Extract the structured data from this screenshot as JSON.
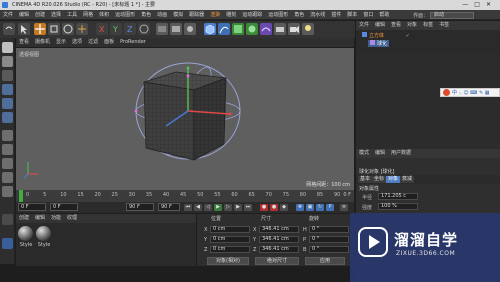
{
  "window": {
    "title": "CINEMA 4D R20.026 Studio (RC - R20) - [未标题 1 *] - 主要",
    "controls": [
      "—",
      "□",
      "✕"
    ]
  },
  "menubar": {
    "items": [
      "文件",
      "编辑",
      "创建",
      "选择",
      "工具",
      "网格",
      "体积",
      "运动图形",
      "角色",
      "动画",
      "模拟",
      "跟踪器",
      "渲染",
      "雕刻",
      "运动跟踪",
      "运动图形",
      "角色",
      "流水线",
      "插件",
      "脚本",
      "窗口",
      "帮助"
    ],
    "highlight_index": 12,
    "layout_label": "界面：",
    "layout_value": "启动"
  },
  "viewport": {
    "menu": [
      "查看",
      "摄像机",
      "显示",
      "选项",
      "过滤",
      "面板",
      "ProRender"
    ],
    "label": "透视视图",
    "grid_distance": "网格间距：100 cm"
  },
  "timeline": {
    "ticks": [
      "0",
      "5",
      "10",
      "15",
      "20",
      "25",
      "30",
      "35",
      "40",
      "45",
      "50",
      "55",
      "60",
      "65",
      "70",
      "75",
      "80",
      "85",
      "90"
    ],
    "end_label": "0 F"
  },
  "playbar": {
    "start": "0 F",
    "start2": "0 F",
    "end": "90 F",
    "end2": "90 F"
  },
  "materials": {
    "menu": [
      "创建",
      "编辑",
      "功能",
      "纹理"
    ],
    "items": [
      "Style",
      "Style"
    ]
  },
  "coords": {
    "headers": [
      "位置",
      "尺寸",
      "旋转"
    ],
    "rows": [
      {
        "axis": "X",
        "pos": "0 cm",
        "size": "346.41 cm",
        "rot_axis": "H",
        "rot": "0 °"
      },
      {
        "axis": "Y",
        "pos": "0 cm",
        "size": "346.41 cm",
        "rot_axis": "P",
        "rot": "0 °"
      },
      {
        "axis": "Z",
        "pos": "0 cm",
        "size": "346.41 cm",
        "rot_axis": "B",
        "rot": "0 °"
      }
    ],
    "mode": "对象(相对)",
    "size_mode": "绝对尺寸",
    "apply": "应用"
  },
  "objects": {
    "menu": [
      "文件",
      "编辑",
      "查看",
      "对象",
      "标签",
      "书签"
    ],
    "rows": [
      "立方体",
      "球化"
    ]
  },
  "attributes": {
    "menu": [
      "模式",
      "编辑",
      "用户数据"
    ],
    "object_label": "球化对象 [球化]",
    "tabs": [
      "基本",
      "坐标",
      "对象",
      "衰减"
    ],
    "active_tab": 2,
    "section": "对象属性",
    "params": [
      {
        "label": "半径",
        "value": "171.205 c"
      },
      {
        "label": "强度",
        "value": "100 %"
      }
    ]
  },
  "watermark": {
    "main": "溜溜自学",
    "sub": "ZIXUE.3D66.COM"
  },
  "ime": {
    "text": "中 ·, ☺ ⌨ ✎ ▦"
  },
  "colors": {
    "accent_orange": "#ff9a3c",
    "selection_blue": "#4f7fc2",
    "viewport_bg": "#5f5f5f",
    "watermark_bg": "#283770"
  }
}
